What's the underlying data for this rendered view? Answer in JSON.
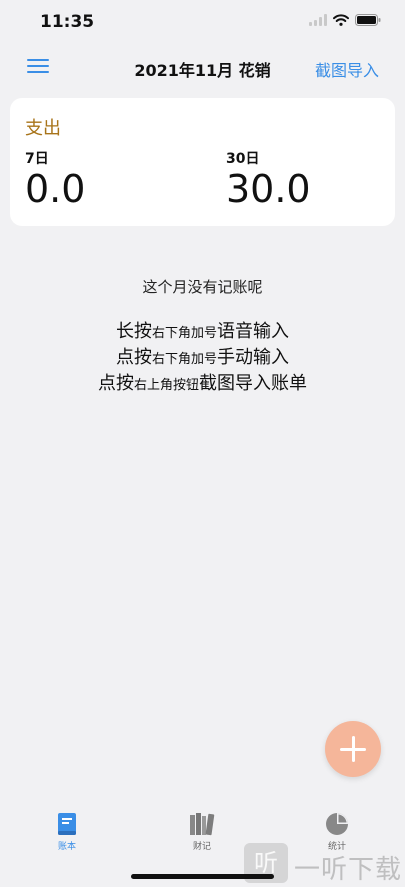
{
  "status_bar": {
    "time": "11:35"
  },
  "nav": {
    "title": "2021年11月 花销",
    "import_label": "截图导入"
  },
  "summary": {
    "title": "支出",
    "left": {
      "label": "7日",
      "value": "0.0"
    },
    "right": {
      "label": "30日",
      "value": "30.0"
    }
  },
  "empty_message": "这个月没有记账呢",
  "instructions": [
    {
      "action": "长按",
      "location": "右下角加号",
      "result": "语音输入"
    },
    {
      "action": "点按",
      "location": "右下角加号",
      "result": "手动输入"
    },
    {
      "action": "点按",
      "location": "右上角按钮",
      "result": "截图导入账单"
    }
  ],
  "tabs": [
    {
      "label": "账本",
      "icon": "ledger-book-icon",
      "active": true
    },
    {
      "label": "财记",
      "icon": "books-icon",
      "active": false
    },
    {
      "label": "统计",
      "icon": "pie-chart-icon",
      "active": false
    }
  ],
  "colors": {
    "accent": "#3a8ee6",
    "expense_title": "#a8741a",
    "fab": "#f5b69a",
    "background": "#f1f1f3",
    "card": "#ffffff"
  },
  "watermark": {
    "logo": "听",
    "text": "一听下载"
  }
}
